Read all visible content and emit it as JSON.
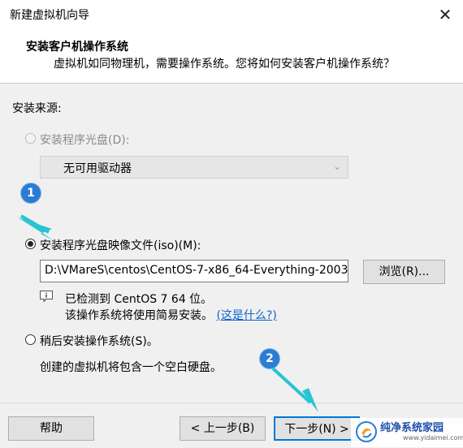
{
  "window": {
    "title": "新建虚拟机向导"
  },
  "header": {
    "title": "安装客户机操作系统",
    "subtitle": "虚拟机如同物理机，需要操作系统。您将如何安装客户机操作系统？"
  },
  "source": {
    "label": "安装来源:",
    "disc_option": {
      "label": "安装程序光盘(D):",
      "selected": false,
      "enabled": false
    },
    "drive_select": {
      "value": "无可用驱动器",
      "enabled": false
    },
    "iso_option": {
      "label": "安装程序光盘映像文件(iso)(M):",
      "selected": true
    },
    "iso_select": {
      "value": "D:\\VMareS\\centos\\CentOS-7-x86_64-Everything-2003"
    },
    "browse_label": "浏览(R)...",
    "detect_line1": "已检测到 CentOS 7 64 位。",
    "detect_line2": "该操作系统将使用简易安装。",
    "what_link": "(这是什么?)",
    "later_option": {
      "label": "稍后安装操作系统(S)。",
      "selected": false
    },
    "later_note": "创建的虚拟机将包含一个空白硬盘。"
  },
  "footer": {
    "help_label": "帮助",
    "back_label": "< 上一步(B)",
    "next_label": "下一步(N) >"
  },
  "annotations": {
    "marker1": "1",
    "marker2": "2",
    "arrow_color": "#29c3d3"
  },
  "watermark": {
    "text": "纯净系统家园",
    "url": "www.yidaimei.com"
  },
  "colors": {
    "accent": "#0078d7",
    "marker": "#2b7cd3",
    "link": "#0b63ce"
  }
}
